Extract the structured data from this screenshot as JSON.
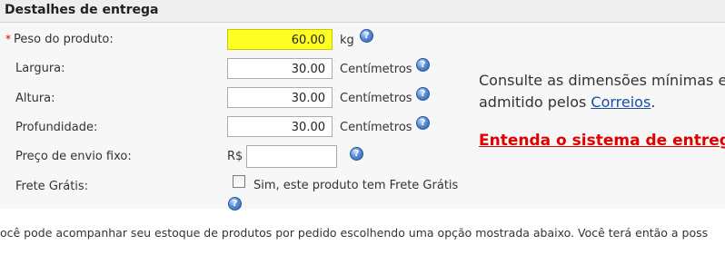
{
  "section": {
    "title": "Destalhes de entrega"
  },
  "required_marker": "*",
  "fields": {
    "weight": {
      "label": "Peso do produto:",
      "value": "60.00",
      "unit": "kg"
    },
    "width": {
      "label": "Largura:",
      "value": "30.00",
      "unit": "Centímetros"
    },
    "height": {
      "label": "Altura:",
      "value": "30.00",
      "unit": "Centímetros"
    },
    "depth": {
      "label": "Profundidade:",
      "value": "30.00",
      "unit": "Centímetros"
    },
    "fixed_shipping": {
      "label": "Preço de envio fixo:",
      "currency": "R$",
      "value": ""
    },
    "free_shipping": {
      "label": "Frete Grátis:",
      "checkbox_label": "Sim, este produto tem Frete Grátis",
      "checked": false
    }
  },
  "info": {
    "line1": "Consulte as dimensões mínimas e",
    "line2_prefix": "admitido pelos ",
    "line2_link": "Correios",
    "line2_suffix": ".",
    "red_link": "Entenda o sistema de entrega"
  },
  "help_icon_glyph": "?",
  "bottom_text": "ocê pode acompanhar seu estoque de produtos por pedido escolhendo uma opção mostrada abaixo. Você terá então a poss",
  "colors": {
    "highlight": "#ffff22",
    "link": "#1a4ea8",
    "red_link": "#e00000",
    "required": "#d40000"
  }
}
